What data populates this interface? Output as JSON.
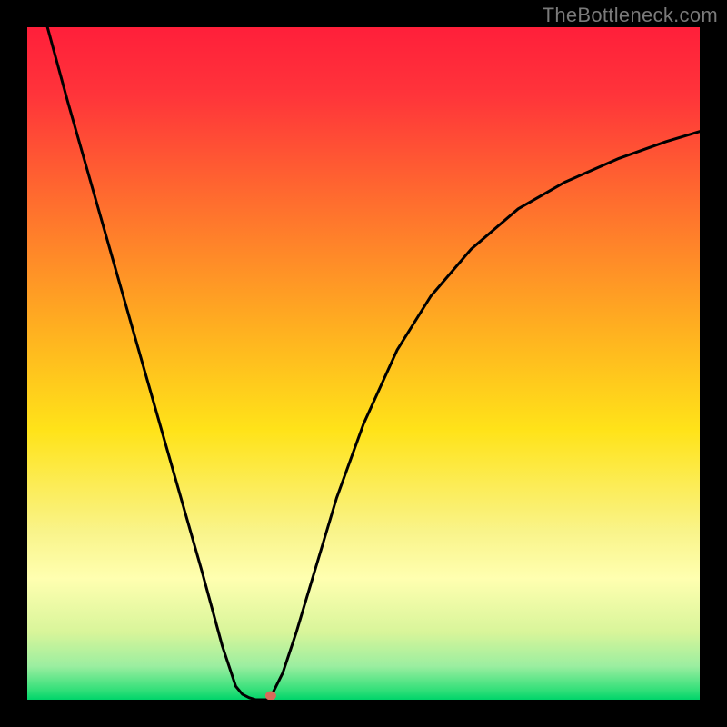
{
  "watermark": "TheBottleneck.com",
  "chart_data": {
    "type": "line",
    "title": "",
    "xlabel": "",
    "ylabel": "",
    "xlim": [
      0,
      100
    ],
    "ylim": [
      0,
      100
    ],
    "background_gradient": {
      "stops": [
        {
          "offset": 0.0,
          "color": "#ff1f3a"
        },
        {
          "offset": 0.1,
          "color": "#ff343a"
        },
        {
          "offset": 0.25,
          "color": "#ff6a2f"
        },
        {
          "offset": 0.45,
          "color": "#ffb020"
        },
        {
          "offset": 0.6,
          "color": "#ffe319"
        },
        {
          "offset": 0.75,
          "color": "#f9f48a"
        },
        {
          "offset": 0.82,
          "color": "#ffffb0"
        },
        {
          "offset": 0.9,
          "color": "#d8f59a"
        },
        {
          "offset": 0.95,
          "color": "#9beea0"
        },
        {
          "offset": 0.985,
          "color": "#35e07a"
        },
        {
          "offset": 1.0,
          "color": "#00d46a"
        }
      ]
    },
    "series": [
      {
        "name": "bottleneck-curve",
        "color": "#000000",
        "left_branch": {
          "x": [
            3,
            6,
            10,
            14,
            18,
            22,
            26,
            29,
            31,
            32,
            33,
            34
          ],
          "y": [
            100,
            89,
            75,
            61,
            47,
            33,
            19,
            8,
            2,
            0.8,
            0.3,
            0
          ]
        },
        "flat": {
          "x": [
            34,
            36
          ],
          "y": [
            0,
            0
          ]
        },
        "right_branch": {
          "x": [
            36,
            38,
            40,
            43,
            46,
            50,
            55,
            60,
            66,
            73,
            80,
            88,
            95,
            100
          ],
          "y": [
            0,
            4,
            10,
            20,
            30,
            41,
            52,
            60,
            67,
            73,
            77,
            80.5,
            83,
            84.5
          ]
        }
      }
    ],
    "marker": {
      "name": "optimal-point",
      "x": 36.2,
      "y": 0.6,
      "color": "#d96a5a",
      "rx": 6,
      "ry": 5
    }
  }
}
